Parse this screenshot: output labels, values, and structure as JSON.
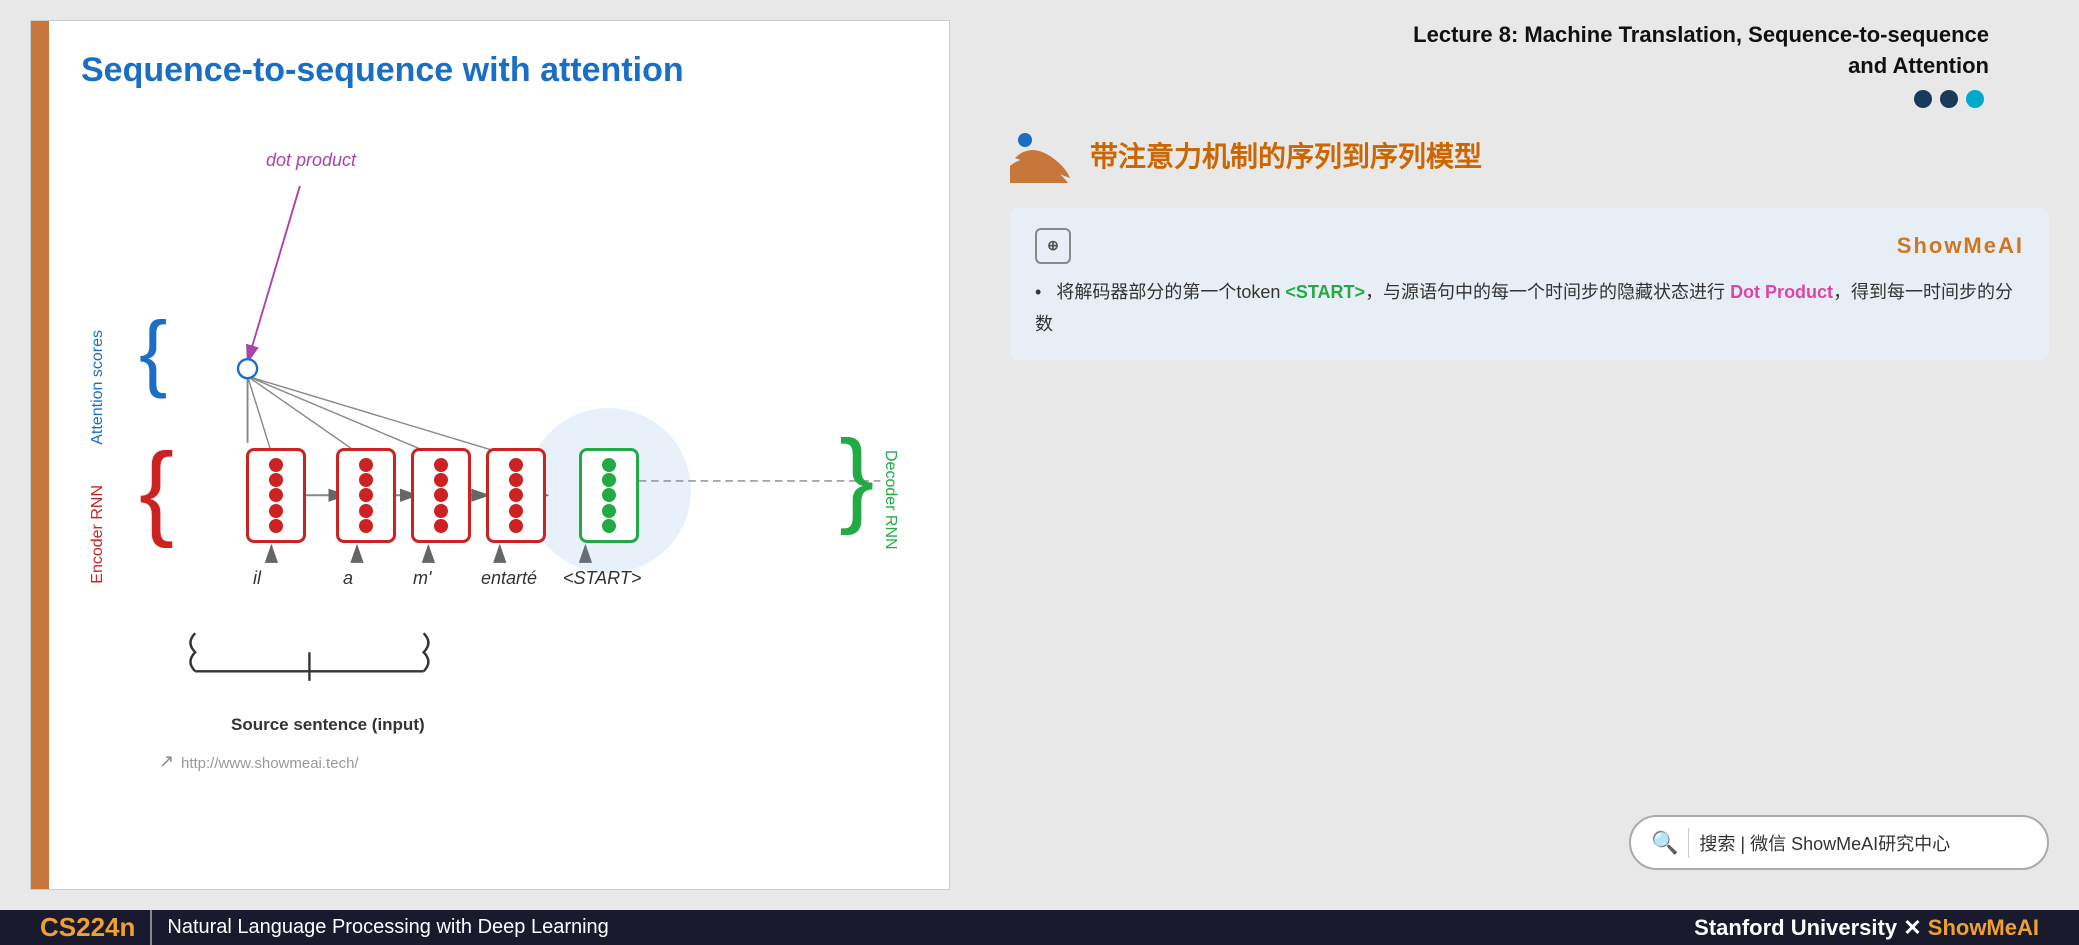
{
  "slide": {
    "title": "Sequence-to-sequence with attention",
    "dot_product_label": "dot product",
    "attention_scores_label": "Attention scores",
    "encoder_rnn_label": "Encoder RNN",
    "decoder_rnn_label": "Decoder RNN",
    "source_sentence_label": "Source sentence (input)",
    "source_url": "http://www.showmeai.tech/",
    "words": [
      "il",
      "a",
      "m'",
      "entarté",
      "<START>"
    ],
    "orange_bar": true
  },
  "lecture": {
    "title": "Lecture 8:  Machine Translation, Sequence-to-sequence\nand Attention",
    "dots": [
      "#1a3a5c",
      "#1a3a5c",
      "#00aacc"
    ],
    "chinese_title": "带注意力机制的序列到序列模型"
  },
  "annotation": {
    "ai_icon_text": "⊕",
    "brand": "ShowMeAI",
    "bullet": "将解码器部分的第一个token <START>，与源语句中的每一个时间步的隐藏状态进行 Dot Product，得到每一时间步的分数",
    "start_token": "<START>",
    "dot_product_term": "Dot Product"
  },
  "search": {
    "icon": "🔍",
    "text": "搜索 | 微信 ShowMeAI研究中心"
  },
  "footer": {
    "course_code": "CS224n",
    "separator": "|",
    "description": "Natural Language Processing with Deep Learning",
    "right_text": "Stanford University",
    "x_text": "✕",
    "showmeai_text": "ShowMeAI"
  }
}
